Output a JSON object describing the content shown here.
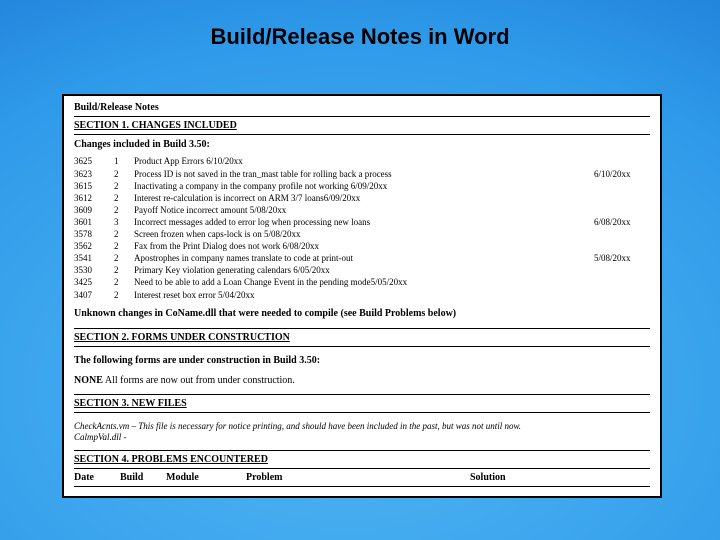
{
  "slide": {
    "title": "Build/Release Notes in Word"
  },
  "doc": {
    "heading": "Build/Release Notes",
    "section1": {
      "title": "SECTION 1.  CHANGES INCLUDED",
      "subtitle": "Changes included in Build 3.50:"
    },
    "rows": [
      {
        "id": "3625",
        "b": "1",
        "desc": "Product App Errors    6/10/20xx",
        "date": ""
      },
      {
        "id": "3623",
        "b": "2",
        "desc": "Process ID is not saved in the tran_mast table for rolling back a process",
        "date": "6/10/20xx"
      },
      {
        "id": "3615",
        "b": "2",
        "desc": "Inactivating a company in the company profile not working  6/09/20xx",
        "date": ""
      },
      {
        "id": "3612",
        "b": "2",
        "desc": "Interest re-calculation is incorrect on ARM 3/7 loans6/09/20xx",
        "date": ""
      },
      {
        "id": "3609",
        "b": "2",
        "desc": "Payoff Notice incorrect amount         5/08/20xx",
        "date": ""
      },
      {
        "id": "3601",
        "b": "3",
        "desc": "Incorrect messages added to error log when processing new loans",
        "date": "6/08/20xx"
      },
      {
        "id": "3578",
        "b": "2",
        "desc": "Screen frozen when caps-lock is on  5/08/20xx",
        "date": ""
      },
      {
        "id": "3562",
        "b": "2",
        "desc": "Fax from the Print Dialog does not work               6/08/20xx",
        "date": ""
      },
      {
        "id": "3541",
        "b": "2",
        "desc": "Apostrophes in company names translate to code at print-out",
        "date": "5/08/20xx"
      },
      {
        "id": "3530",
        "b": "2",
        "desc": "Primary Key violation generating calendars  6/05/20xx",
        "date": ""
      },
      {
        "id": "3425",
        "b": "2",
        "desc": "Need to be able to add a Loan Change Event in the pending mode5/05/20xx",
        "date": ""
      },
      {
        "id": "3407",
        "b": "2",
        "desc": "Interest reset box error         5/04/20xx",
        "date": ""
      }
    ],
    "unknown": "Unknown changes in CoName.dll that were needed to compile (see Build Problems below)",
    "section2": {
      "title": "SECTION 2.  FORMS UNDER CONSTRUCTION",
      "subtitle": "The following forms are under construction in Build 3.50:",
      "body_prefix": "NONE",
      "body_rest": "  All forms are now out from under construction."
    },
    "section3": {
      "title": "SECTION 3.   NEW FILES",
      "file1_name": "CheckAcnts.vm",
      "file1_rest": " – This file is necessary for notice printing, and should have been included in the past, but was not until now.",
      "file2": "CalmpVal.dll -"
    },
    "section4": {
      "title": "SECTION 4.   PROBLEMS ENCOUNTERED",
      "cols": [
        "Date",
        "Build",
        "Module",
        "Problem",
        "Solution"
      ]
    }
  }
}
